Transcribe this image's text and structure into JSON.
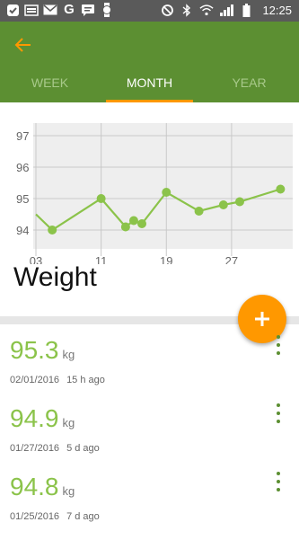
{
  "status_bar": {
    "time": "12:25",
    "left_icons": [
      "check-icon",
      "keyboard-icon",
      "mail-icon",
      "google-icon",
      "chat-icon",
      "watch-icon"
    ],
    "right_icons": [
      "sync-icon",
      "bluetooth-icon",
      "wifi-icon",
      "signal-icon",
      "battery-icon"
    ]
  },
  "header": {
    "back_icon": "back-arrow-icon",
    "tabs": [
      {
        "label": "WEEK",
        "active": false
      },
      {
        "label": "MONTH",
        "active": true
      },
      {
        "label": "YEAR",
        "active": false
      }
    ]
  },
  "chart_data": {
    "type": "line",
    "x_tick_labels": [
      "03",
      "11",
      "19",
      "27"
    ],
    "y_tick_labels": [
      "97",
      "96",
      "95",
      "94"
    ],
    "ylim": [
      93.4,
      97.4
    ],
    "xlim": [
      3,
      34.5
    ],
    "grid": true,
    "x": [
      3,
      5,
      11,
      14,
      15,
      16,
      19,
      23,
      26,
      28,
      33
    ],
    "values": [
      94.5,
      94.0,
      95.0,
      94.1,
      94.3,
      94.2,
      95.2,
      94.6,
      94.8,
      94.9,
      95.3
    ]
  },
  "section_title": "Weight",
  "fab": {
    "icon": "plus-icon"
  },
  "entries": [
    {
      "value": "95.3",
      "unit": "kg",
      "date": "02/01/2016",
      "ago": "15 h ago"
    },
    {
      "value": "94.9",
      "unit": "kg",
      "date": "01/27/2016",
      "ago": "5 d ago"
    },
    {
      "value": "94.8",
      "unit": "kg",
      "date": "01/25/2016",
      "ago": "7 d ago"
    }
  ],
  "colors": {
    "primary": "#5c8f32",
    "accent": "#ff9800",
    "line": "#8bc34a"
  }
}
